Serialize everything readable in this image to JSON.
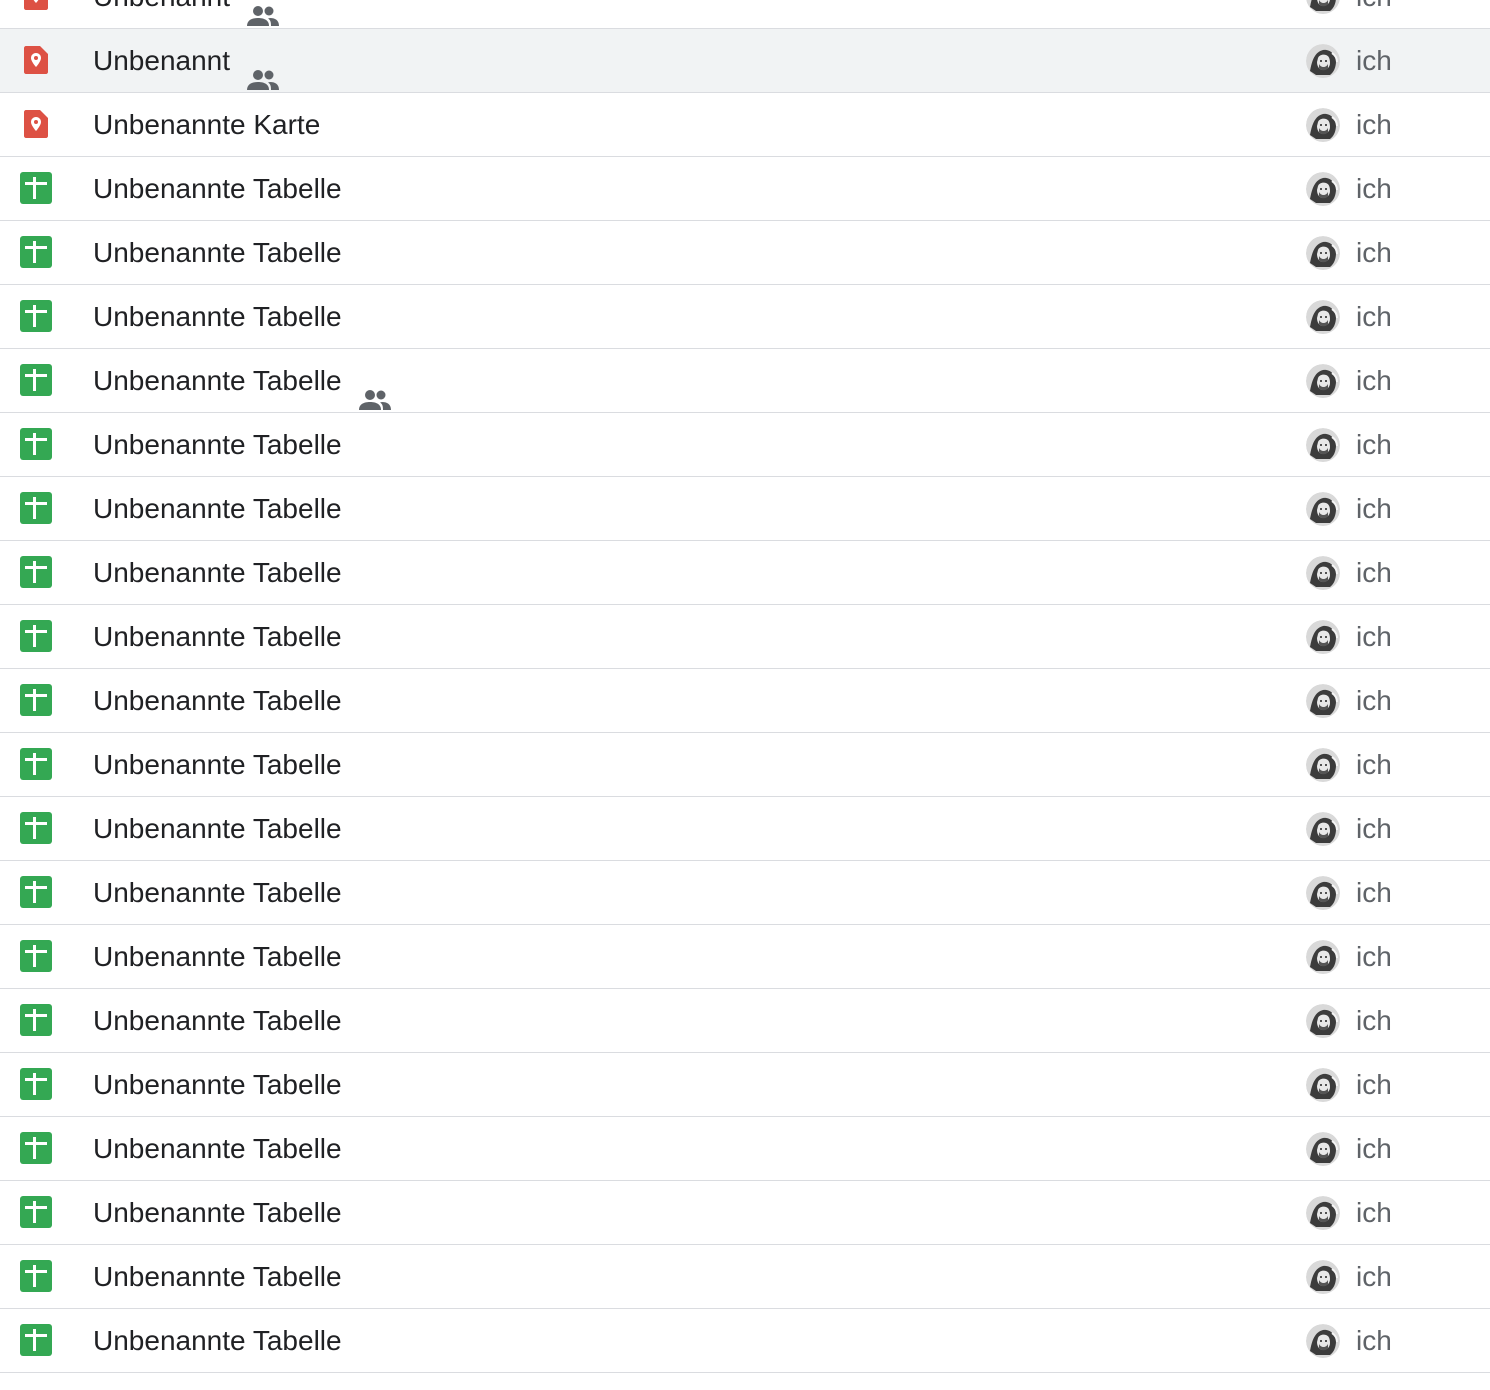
{
  "files": [
    {
      "name": "Unbenannt",
      "type": "map",
      "shared": true,
      "owner": "ich",
      "selected": false
    },
    {
      "name": "Unbenannt",
      "type": "map",
      "shared": true,
      "owner": "ich",
      "selected": true
    },
    {
      "name": "Unbenannte Karte",
      "type": "map",
      "shared": false,
      "owner": "ich",
      "selected": false
    },
    {
      "name": "Unbenannte Tabelle",
      "type": "sheet",
      "shared": false,
      "owner": "ich",
      "selected": false
    },
    {
      "name": "Unbenannte Tabelle",
      "type": "sheet",
      "shared": false,
      "owner": "ich",
      "selected": false
    },
    {
      "name": "Unbenannte Tabelle",
      "type": "sheet",
      "shared": false,
      "owner": "ich",
      "selected": false
    },
    {
      "name": "Unbenannte Tabelle",
      "type": "sheet",
      "shared": true,
      "owner": "ich",
      "selected": false
    },
    {
      "name": "Unbenannte Tabelle",
      "type": "sheet",
      "shared": false,
      "owner": "ich",
      "selected": false
    },
    {
      "name": "Unbenannte Tabelle",
      "type": "sheet",
      "shared": false,
      "owner": "ich",
      "selected": false
    },
    {
      "name": "Unbenannte Tabelle",
      "type": "sheet",
      "shared": false,
      "owner": "ich",
      "selected": false
    },
    {
      "name": "Unbenannte Tabelle",
      "type": "sheet",
      "shared": false,
      "owner": "ich",
      "selected": false
    },
    {
      "name": "Unbenannte Tabelle",
      "type": "sheet",
      "shared": false,
      "owner": "ich",
      "selected": false
    },
    {
      "name": "Unbenannte Tabelle",
      "type": "sheet",
      "shared": false,
      "owner": "ich",
      "selected": false
    },
    {
      "name": "Unbenannte Tabelle",
      "type": "sheet",
      "shared": false,
      "owner": "ich",
      "selected": false
    },
    {
      "name": "Unbenannte Tabelle",
      "type": "sheet",
      "shared": false,
      "owner": "ich",
      "selected": false
    },
    {
      "name": "Unbenannte Tabelle",
      "type": "sheet",
      "shared": false,
      "owner": "ich",
      "selected": false
    },
    {
      "name": "Unbenannte Tabelle",
      "type": "sheet",
      "shared": false,
      "owner": "ich",
      "selected": false
    },
    {
      "name": "Unbenannte Tabelle",
      "type": "sheet",
      "shared": false,
      "owner": "ich",
      "selected": false
    },
    {
      "name": "Unbenannte Tabelle",
      "type": "sheet",
      "shared": false,
      "owner": "ich",
      "selected": false
    },
    {
      "name": "Unbenannte Tabelle",
      "type": "sheet",
      "shared": false,
      "owner": "ich",
      "selected": false
    },
    {
      "name": "Unbenannte Tabelle",
      "type": "sheet",
      "shared": false,
      "owner": "ich",
      "selected": false
    },
    {
      "name": "Unbenannte Tabelle",
      "type": "sheet",
      "shared": false,
      "owner": "ich",
      "selected": false
    }
  ],
  "colors": {
    "map_icon": "#dd5144",
    "sheet_icon": "#34a853",
    "selected_row": "#f1f3f4",
    "divider": "#dadce0",
    "shared_icon": "#5f6368"
  }
}
